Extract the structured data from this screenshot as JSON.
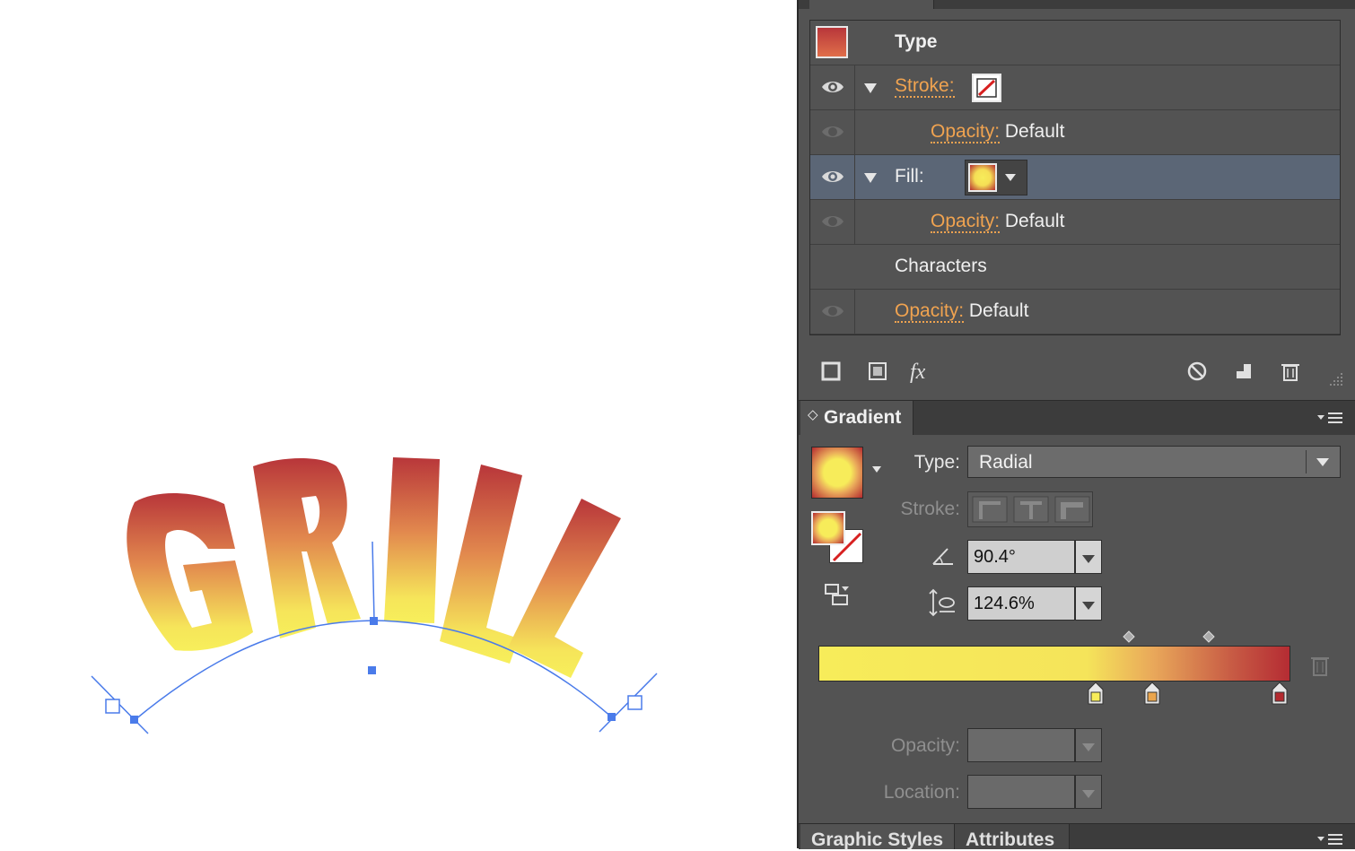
{
  "appearance": {
    "header_label": "Type",
    "rows": [
      {
        "label": "Stroke:"
      },
      {
        "label": "Opacity:",
        "value": "Default"
      },
      {
        "label": "Fill:"
      },
      {
        "label": "Opacity:",
        "value": "Default"
      },
      {
        "label": "Characters"
      },
      {
        "label": "Opacity:",
        "value": "Default"
      }
    ],
    "toolbar_fx": "fx"
  },
  "gradient": {
    "tab_label": "Gradient",
    "type_label": "Type:",
    "type_value": "Radial",
    "stroke_label": "Stroke:",
    "angle_value": "90.4°",
    "aspect_value": "124.6%",
    "opacity_label": "Opacity:",
    "location_label": "Location:",
    "stops": [
      {
        "color": "#f7ec5a",
        "location": 0.59
      },
      {
        "color": "#eaa54c",
        "location": 0.71
      },
      {
        "color": "#b42a2f",
        "location": 0.98
      }
    ],
    "midpoints": [
      0.66,
      0.83
    ]
  },
  "bottom_tabs": [
    "Graphic Styles",
    "Attributes"
  ],
  "artwork": {
    "text": "GRILL",
    "fill_colors": {
      "top": "#b8363a",
      "middle": "#e2894e",
      "bottom": "#f7ef5b"
    },
    "path_color": "#4a7bea"
  }
}
